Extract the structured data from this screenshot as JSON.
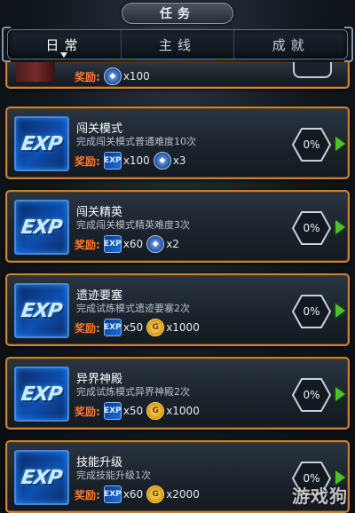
{
  "header": {
    "title": "任务"
  },
  "tabs": [
    {
      "label": "日常",
      "active": true
    },
    {
      "label": "主线",
      "active": false
    },
    {
      "label": "成就",
      "active": false
    }
  ],
  "partial_task": {
    "reward_label": "奖励:",
    "rewards": [
      {
        "icon": "crystal-icon",
        "qty": "x100"
      }
    ]
  },
  "tasks": [
    {
      "name": "闯关模式",
      "desc": "完成闯关模式普通难度10次",
      "reward_label": "奖励:",
      "rewards": [
        {
          "icon": "exp-icon",
          "qty": "x100"
        },
        {
          "icon": "crystal-icon",
          "qty": "x3"
        }
      ],
      "progress": "0%"
    },
    {
      "name": "闯关精英",
      "desc": "完成闯关模式精英难度3次",
      "reward_label": "奖励:",
      "rewards": [
        {
          "icon": "exp-icon",
          "qty": "x60"
        },
        {
          "icon": "crystal-icon",
          "qty": "x2"
        }
      ],
      "progress": "0%"
    },
    {
      "name": "遗迹要塞",
      "desc": "完成试炼模式遗迹要塞2次",
      "reward_label": "奖励:",
      "rewards": [
        {
          "icon": "exp-icon",
          "qty": "x50"
        },
        {
          "icon": "gold-coin-icon",
          "qty": "x1000"
        }
      ],
      "progress": "0%"
    },
    {
      "name": "异界神殿",
      "desc": "完成试炼模式异界神殿2次",
      "reward_label": "奖励:",
      "rewards": [
        {
          "icon": "exp-icon",
          "qty": "x50"
        },
        {
          "icon": "gold-coin-icon",
          "qty": "x1000"
        }
      ],
      "progress": "0%"
    },
    {
      "name": "技能升级",
      "desc": "完成技能升级1次",
      "reward_label": "奖励:",
      "rewards": [
        {
          "icon": "exp-icon",
          "qty": "x60"
        },
        {
          "icon": "gold-coin-icon",
          "qty": "x2000"
        }
      ],
      "progress": "0%"
    }
  ],
  "exp_badge_text": "EXP",
  "watermark": "游戏狗",
  "colors": {
    "card_border": "#c9822e",
    "reward_label": "#ff7a2e",
    "go_arrow": "#4fbf2a"
  }
}
